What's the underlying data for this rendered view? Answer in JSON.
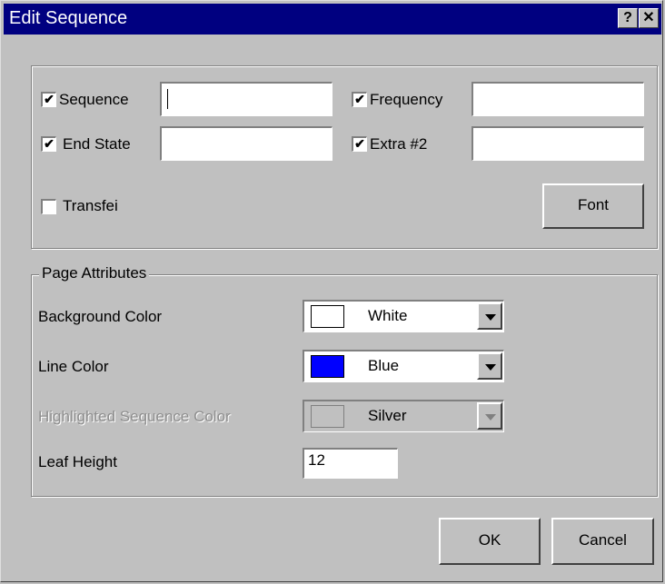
{
  "dialog": {
    "title": "Edit Sequence",
    "help_button": "?",
    "close_button": "✕"
  },
  "top_group": {
    "fields": [
      {
        "label": "Sequence",
        "checked": true,
        "value": ""
      },
      {
        "label": "Frequency",
        "checked": true,
        "value": ""
      },
      {
        "label": "End State",
        "checked": true,
        "value": ""
      },
      {
        "label": "Extra #2",
        "checked": true,
        "value": ""
      }
    ],
    "transfer": {
      "label": "Transfei",
      "checked": false
    },
    "font_button": "Font"
  },
  "page_attributes": {
    "legend": "Page Attributes",
    "background_color": {
      "label": "Background Color",
      "value": "White",
      "swatch": "#ffffff"
    },
    "line_color": {
      "label": "Line Color",
      "value": "Blue",
      "swatch": "#0000ff"
    },
    "highlight_color": {
      "label": "Highlighted Sequence Color",
      "value": "Silver",
      "swatch": "#c0c0c0",
      "disabled": true
    },
    "leaf_height": {
      "label": "Leaf Height",
      "value": "12"
    }
  },
  "buttons": {
    "ok": "OK",
    "cancel": "Cancel"
  },
  "check_mark": "✔"
}
